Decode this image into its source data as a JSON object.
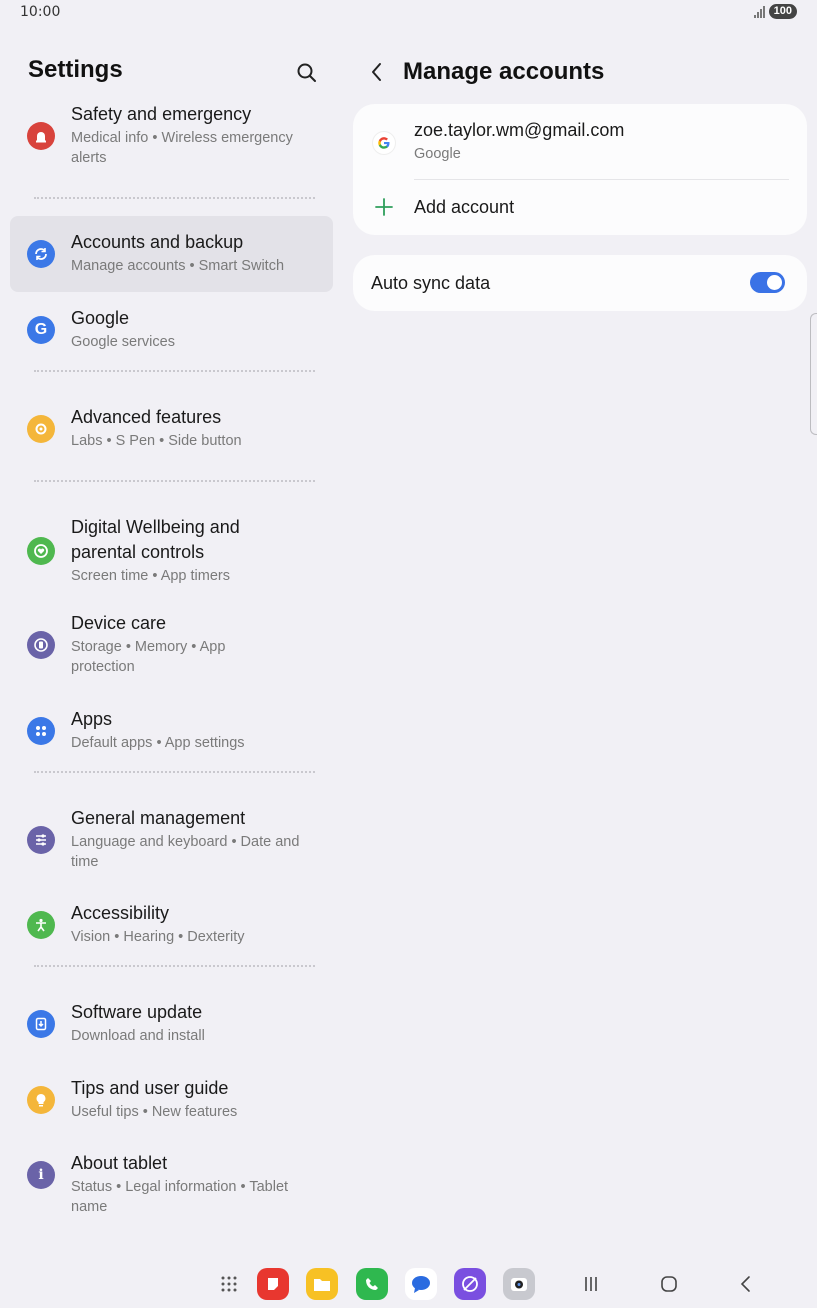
{
  "status_bar": {
    "time": "10:00",
    "battery": "100"
  },
  "left_pane": {
    "title": "Settings",
    "items": [
      {
        "title": "Safety and emergency",
        "subtitle": "Medical info  •  Wireless emergency alerts",
        "icon": "siren-icon",
        "color": "#d8433c"
      },
      {
        "title": "Accounts and backup",
        "subtitle": "Manage accounts  •  Smart Switch",
        "icon": "sync-icon",
        "color": "#3b78e7",
        "active": true
      },
      {
        "title": "Google",
        "subtitle": "Google services",
        "icon": "google-icon",
        "color": "#3b78e7"
      },
      {
        "title": "Advanced features",
        "subtitle": "Labs  •  S Pen  •  Side button",
        "icon": "gear-plus-icon",
        "color": "#f4b63a"
      },
      {
        "title": "Digital Wellbeing and parental controls",
        "subtitle": "Screen time  •  App timers",
        "icon": "wellbeing-icon",
        "color": "#4fb84f"
      },
      {
        "title": "Device care",
        "subtitle": "Storage  •  Memory  •  App protection",
        "icon": "device-care-icon",
        "color": "#6a63a8"
      },
      {
        "title": "Apps",
        "subtitle": "Default apps  •  App settings",
        "icon": "apps-icon",
        "color": "#3b78e7"
      },
      {
        "title": "General management",
        "subtitle": "Language and keyboard  •  Date and time",
        "icon": "sliders-icon",
        "color": "#6a63a8"
      },
      {
        "title": "Accessibility",
        "subtitle": "Vision  •  Hearing  •  Dexterity",
        "icon": "accessibility-icon",
        "color": "#4fb84f"
      },
      {
        "title": "Software update",
        "subtitle": "Download and install",
        "icon": "download-icon",
        "color": "#3b78e7"
      },
      {
        "title": "Tips and user guide",
        "subtitle": "Useful tips  •  New features",
        "icon": "bulb-icon",
        "color": "#f4b63a"
      },
      {
        "title": "About tablet",
        "subtitle": "Status  •  Legal information  •  Tablet name",
        "icon": "info-icon",
        "color": "#6a63a8"
      }
    ]
  },
  "right_pane": {
    "title": "Manage accounts",
    "account": {
      "email": "zoe.taylor.wm@gmail.com",
      "type": "Google"
    },
    "add_account": "Add account",
    "auto_sync": {
      "label": "Auto sync data",
      "enabled": true
    }
  },
  "dock": {
    "apps": [
      "apps-grid-icon",
      "notes-app-icon",
      "files-app-icon",
      "phone-app-icon",
      "messages-app-icon",
      "browser-app-icon",
      "camera-app-icon"
    ],
    "nav": [
      "recents-nav-icon",
      "home-nav-icon",
      "back-nav-icon"
    ]
  }
}
